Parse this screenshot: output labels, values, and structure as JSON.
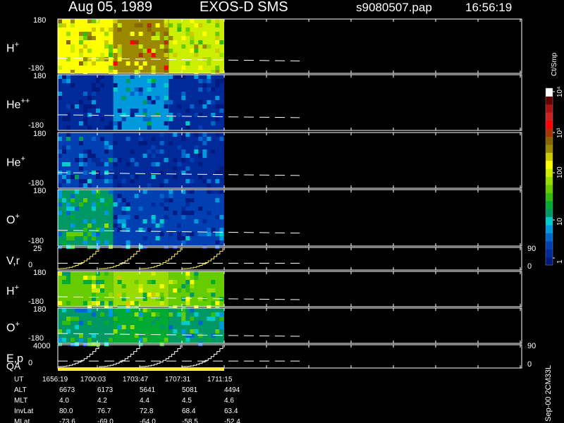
{
  "header": {
    "date": "Aug 05, 1989",
    "instrument": "EXOS-D SMS",
    "file": "s9080507.pap",
    "time": "16:56:19"
  },
  "colors": {
    "background": "#000000",
    "axis": "#ffffff",
    "line_overlay": "#ffffff",
    "vr_line": "#ffee66",
    "qa_bar": "#ffee33"
  },
  "colorbar": {
    "unit": "Ct/Smp",
    "ticks": [
      "1",
      "10",
      "100",
      "10³",
      "10⁴"
    ],
    "colors": [
      "#001a80",
      "#002a99",
      "#0040b3",
      "#0066cc",
      "#0099dd",
      "#00cccc",
      "#009966",
      "#00aa33",
      "#33bb11",
      "#66cc00",
      "#99dd00",
      "#ccee00",
      "#ffff00",
      "#cccc00",
      "#998800",
      "#886600",
      "#aa3300",
      "#ff0000",
      "#cc2222",
      "#aa1111",
      "#660000",
      "#ffffff"
    ]
  },
  "side_label": "Sep-00 2CM33L",
  "chart_data": [
    {
      "type": "heatmap",
      "label": "H",
      "sup": "+",
      "ylim": [
        -180,
        180
      ],
      "ytick_labels": [
        "180",
        "-180"
      ],
      "segments": [
        {
          "x_start": "1656:19",
          "x_end": "1700:03",
          "level": 0.58
        },
        {
          "x_start": "1700:03",
          "x_end": "1703:47",
          "level": 0.68
        },
        {
          "x_start": "1703:47",
          "x_end": "1707:31",
          "level": 0.55
        }
      ]
    },
    {
      "type": "heatmap",
      "label": "He",
      "sup": "++",
      "ylim": [
        -180,
        180
      ],
      "ytick_labels": [
        "180",
        "-180"
      ],
      "segments": [
        {
          "x_start": "1656:19",
          "x_end": "1700:03",
          "level": 0.05
        },
        {
          "x_start": "1700:03",
          "x_end": "1703:47",
          "level": 0.18
        },
        {
          "x_start": "1703:47",
          "x_end": "1707:31",
          "level": 0.06
        }
      ]
    },
    {
      "type": "heatmap",
      "label": "He",
      "sup": "+",
      "ylim": [
        -180,
        180
      ],
      "ytick_labels": [
        "180",
        "-180"
      ],
      "segments": [
        {
          "x_start": "1656:19",
          "x_end": "1700:03",
          "level": 0.12
        },
        {
          "x_start": "1700:03",
          "x_end": "1703:47",
          "level": 0.06
        },
        {
          "x_start": "1703:47",
          "x_end": "1707:31",
          "level": 0.06
        }
      ]
    },
    {
      "type": "heatmap",
      "label": "O",
      "sup": "+",
      "ylim": [
        -180,
        180
      ],
      "ytick_labels": [
        "180",
        "-180"
      ],
      "segments": [
        {
          "x_start": "1656:19",
          "x_end": "1700:03",
          "level": 0.32
        },
        {
          "x_start": "1700:03",
          "x_end": "1703:47",
          "level": 0.1
        },
        {
          "x_start": "1703:47",
          "x_end": "1707:31",
          "level": 0.08
        }
      ]
    },
    {
      "type": "line",
      "label": "V,r",
      "ylim": [
        0,
        25
      ],
      "ytick_labels": [
        "25",
        "0"
      ],
      "right_ticks": [
        "90",
        "0"
      ]
    },
    {
      "type": "heatmap",
      "label": "H",
      "sup": "+",
      "ylim": [
        -180,
        180
      ],
      "ytick_labels": [
        "180",
        "-180"
      ],
      "segments": [
        {
          "x_start": "1656:19",
          "x_end": "1700:03",
          "level": 0.45
        },
        {
          "x_start": "1700:03",
          "x_end": "1703:47",
          "level": 0.5
        },
        {
          "x_start": "1703:47",
          "x_end": "1707:31",
          "level": 0.45
        }
      ]
    },
    {
      "type": "heatmap",
      "label": "O",
      "sup": "+",
      "ylim": [
        -180,
        180
      ],
      "ytick_labels": [
        "180",
        "-180"
      ],
      "segments": [
        {
          "x_start": "1656:19",
          "x_end": "1700:03",
          "level": 0.3
        },
        {
          "x_start": "1700:03",
          "x_end": "1703:47",
          "level": 0.35
        },
        {
          "x_start": "1703:47",
          "x_end": "1707:31",
          "level": 0.3
        }
      ]
    },
    {
      "type": "line",
      "label": "E,p",
      "ylim": [
        0,
        4000
      ],
      "ytick_labels": [
        "4000",
        "0"
      ],
      "right_ticks": [
        "90",
        "0"
      ]
    }
  ],
  "qa": {
    "label": "QA",
    "x_start": "1656:19",
    "x_end": "1707:31"
  },
  "table": {
    "rows": [
      {
        "label": "UT",
        "values": [
          "1656:19",
          "1700:03",
          "1703:47",
          "1707:31",
          "1711:15"
        ]
      },
      {
        "label": "ALT",
        "values": [
          "6673",
          "6173",
          "5641",
          "5081",
          "4494"
        ]
      },
      {
        "label": "MLT",
        "values": [
          "4.0",
          "4.2",
          "4.4",
          "4.5",
          "4.6"
        ]
      },
      {
        "label": "InvLat",
        "values": [
          "80.0",
          "76.7",
          "72.8",
          "68.4",
          "63.4"
        ]
      },
      {
        "label": "MLat",
        "values": [
          "-73.6",
          "-69.0",
          "-64.0",
          "-58.5",
          "-52.4"
        ]
      }
    ]
  }
}
